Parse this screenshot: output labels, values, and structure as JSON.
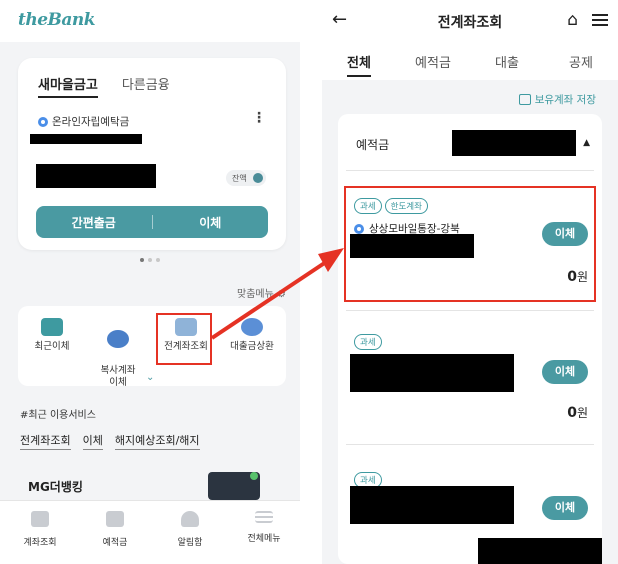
{
  "left": {
    "logo": "theBank",
    "card": {
      "tab_active": "새마을금고",
      "tab_other": "다른금융",
      "account_name": "온라인자립예탁금",
      "balance_toggle_label": "잔액",
      "quick_withdraw_label": "간편출금",
      "transfer_label": "이체"
    },
    "custom_menu_label": "맞춤메뉴",
    "menu_items": [
      {
        "label": "최근이체",
        "icon": "recent-transfer-icon"
      },
      {
        "label": "복사계좌\n이체",
        "icon": "copy-account-icon"
      },
      {
        "label": "전계좌조회",
        "icon": "account-inquiry-icon"
      },
      {
        "label": "대출금상환",
        "icon": "loan-repay-icon"
      }
    ],
    "recent_services_title": "#최근 이용서비스",
    "recent_links": [
      "전계좌조회",
      "이체",
      "해지예상조회/해지"
    ],
    "banner_title": "MG더뱅킹",
    "bottom_nav": [
      "계좌조회",
      "예적금",
      "알림함",
      "전체메뉴"
    ]
  },
  "right": {
    "title": "전계좌조회",
    "tabs": [
      "전체",
      "예적금",
      "대출",
      "공제"
    ],
    "save_link": "보유계좌 저장",
    "section_label": "예적금",
    "accounts": [
      {
        "badges": [
          "과세",
          "한도계좌"
        ],
        "name": "상상모바일통장-강북",
        "amount": "0",
        "currency": "원",
        "button": "이체"
      },
      {
        "badges": [
          "과세"
        ],
        "amount": "0",
        "currency": "원",
        "button": "이체"
      },
      {
        "badges": [
          "과세"
        ],
        "button": "이체"
      }
    ]
  },
  "colors": {
    "accent": "#4a9aa2",
    "highlight": "#e53224"
  }
}
